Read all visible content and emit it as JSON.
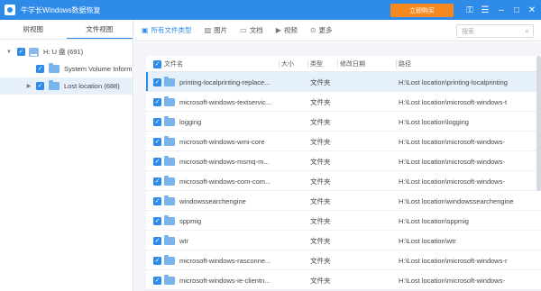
{
  "titlebar": {
    "title": "牛学长Windows数据恢复",
    "buy_label": "立即购买",
    "icons": [
      "key-icon",
      "menu-icon",
      "minimize-icon",
      "restore-icon",
      "close-icon"
    ]
  },
  "left_panel": {
    "tabs": [
      "树视图",
      "文件视图"
    ],
    "tree": [
      {
        "label": "H: U 盘 (691)",
        "expanded": true
      },
      {
        "label": "System Volume Inform"
      },
      {
        "label": "Lost location (688)",
        "selected": true
      }
    ]
  },
  "toolbar": {
    "items": [
      {
        "label": "所有文件类型",
        "icon": "all-files-icon",
        "active": true
      },
      {
        "label": "图片",
        "icon": "image-icon"
      },
      {
        "label": "文档",
        "icon": "document-icon"
      },
      {
        "label": "视频",
        "icon": "video-icon"
      },
      {
        "label": "更多",
        "icon": "more-icon"
      }
    ],
    "search_placeholder": "搜索"
  },
  "table": {
    "headers": {
      "name": "文件名",
      "size": "大小",
      "type": "类型",
      "date": "修改日期",
      "path": "路径"
    },
    "rows": [
      {
        "name": "printing-localprinting-replace...",
        "type": "文件夹",
        "path": "H:\\Lost location\\printing-localprinting",
        "selected": true
      },
      {
        "name": "microsoft-windows-textservic...",
        "type": "文件夹",
        "path": "H:\\Lost location\\microsoft-windows-t"
      },
      {
        "name": "logging",
        "type": "文件夹",
        "path": "H:\\Lost location\\logging"
      },
      {
        "name": "microsoft-windows-wmi-core",
        "type": "文件夹",
        "path": "H:\\Lost location\\microsoft-windows-"
      },
      {
        "name": "microsoft-windows-msmq-m...",
        "type": "文件夹",
        "path": "H:\\Lost location\\microsoft-windows-"
      },
      {
        "name": "microsoft-windows-com-com...",
        "type": "文件夹",
        "path": "H:\\Lost location\\microsoft-windows-"
      },
      {
        "name": "windowssearchengine",
        "type": "文件夹",
        "path": "H:\\Lost location\\windowssearchengine"
      },
      {
        "name": "sppmig",
        "type": "文件夹",
        "path": "H:\\Lost location\\sppmig"
      },
      {
        "name": "wtr",
        "type": "文件夹",
        "path": "H:\\Lost location\\wtr"
      },
      {
        "name": "microsoft-windows-rasconne...",
        "type": "文件夹",
        "path": "H:\\Lost location\\microsoft-windows-r"
      },
      {
        "name": "microsoft-windows-ie-clientn...",
        "type": "文件夹",
        "path": "H:\\Lost location\\microsoft-windows-"
      }
    ]
  },
  "colors": {
    "accent": "#2e8be8",
    "buy": "#f5891f"
  }
}
